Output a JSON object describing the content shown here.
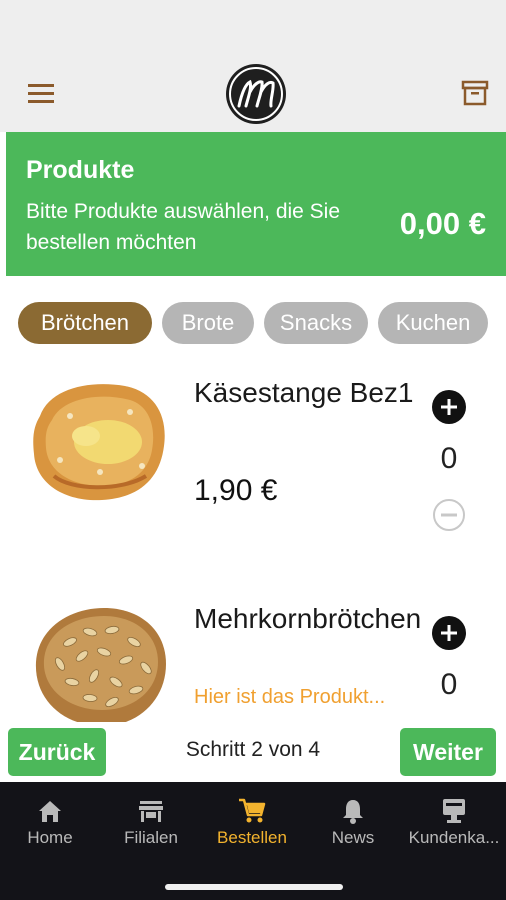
{
  "header": {
    "title": "Produkte",
    "subtitle": "Bitte Produkte auswählen, die Sie bestellen möchten",
    "total": "0,00 €"
  },
  "icons": {
    "menu": "hamburger-menu-icon",
    "logo": "m-logo",
    "archive": "archive-box-icon"
  },
  "categories": [
    {
      "label": "Brötchen",
      "active": true
    },
    {
      "label": "Brote",
      "active": false
    },
    {
      "label": "Snacks",
      "active": false
    },
    {
      "label": "Kuchen",
      "active": false
    }
  ],
  "products": [
    {
      "name": "Käsestange Bez1",
      "price": "1,90 €",
      "quantity": "0"
    },
    {
      "name": "Mehrkornbrötchen",
      "note": "Hier ist das Produkt...",
      "quantity": "0"
    }
  ],
  "stepper": {
    "back_label": "Zurück",
    "step_text": "Schritt 2 von 4",
    "next_label": "Weiter"
  },
  "nav": [
    {
      "label": "Home",
      "icon": "home-icon"
    },
    {
      "label": "Filialen",
      "icon": "store-icon"
    },
    {
      "label": "Bestellen",
      "icon": "cart-icon",
      "active": true
    },
    {
      "label": "News",
      "icon": "bell-icon"
    },
    {
      "label": "Kundenka...",
      "icon": "card-icon"
    }
  ],
  "colors": {
    "accent_green": "#4cb85a",
    "category_active": "#8b6a33",
    "category_inactive": "#b5b5b5",
    "nav_active": "#f3b32e",
    "note_orange": "#f0a030"
  }
}
